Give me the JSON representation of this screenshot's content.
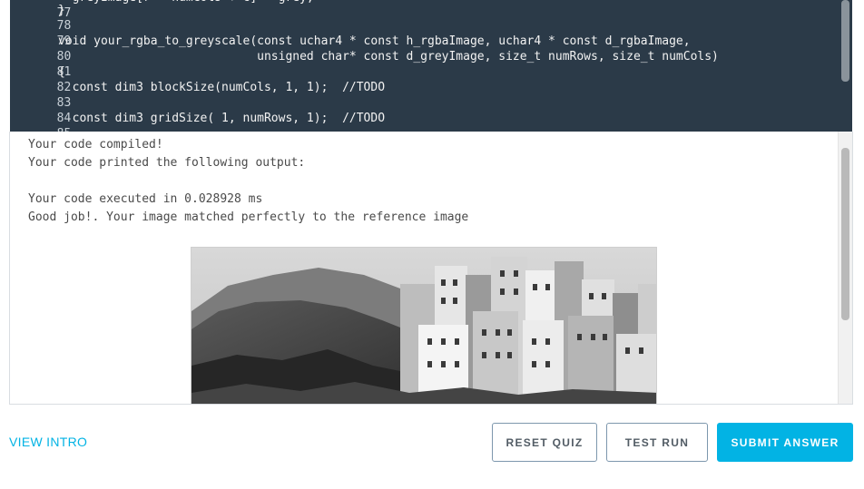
{
  "editor": {
    "lines": [
      {
        "num": "78",
        "text": "}"
      },
      {
        "num": "79",
        "text": ""
      },
      {
        "num": "80",
        "text": "void your_rgba_to_greyscale(const uchar4 * const h_rgbaImage, uchar4 * const d_rgbaImage,"
      },
      {
        "num": "81",
        "text": "                            unsigned char* const d_greyImage, size_t numRows, size_t numCols)"
      },
      {
        "num": "82",
        "text": "{"
      },
      {
        "num": "83",
        "text": "  const dim3 blockSize(numCols, 1, 1);  //TODO"
      },
      {
        "num": "84",
        "text": ""
      },
      {
        "num": "85",
        "text": "  const dim3 gridSize( 1, numRows, 1);  //TODO"
      },
      {
        "num": "86",
        "text": ""
      }
    ]
  },
  "output": {
    "lines": [
      "Your code compiled!",
      "Your code printed the following output:",
      "",
      "Your code executed in 0.028928 ms",
      "Good job!. Your image matched perfectly to the reference image"
    ]
  },
  "footer": {
    "view_intro": "VIEW INTRO",
    "reset_quiz": "RESET QUIZ",
    "test_run": "TEST RUN",
    "submit_answer": "SUBMIT ANSWER"
  },
  "colors": {
    "accent": "#02b3e4",
    "editor_bg": "#2b3a48"
  }
}
